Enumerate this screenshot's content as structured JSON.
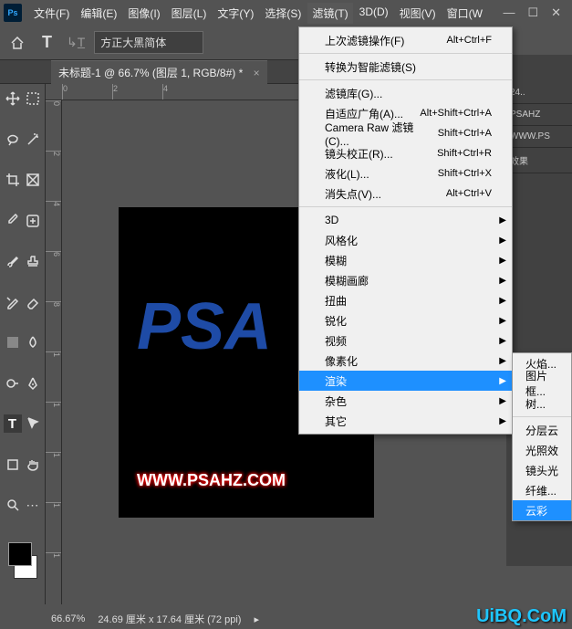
{
  "app": {
    "logo": "Ps"
  },
  "menubar": [
    "文件(F)",
    "编辑(E)",
    "图像(I)",
    "图层(L)",
    "文字(Y)",
    "选择(S)",
    "滤镜(T)",
    "3D(D)",
    "视图(V)",
    "窗口(W"
  ],
  "toolbar": {
    "font": "方正大黑简体"
  },
  "doc_tab": "未标题-1 @ 66.7% (图层 1, RGB/8#) *",
  "ruler_h": [
    "0",
    "2",
    "4"
  ],
  "ruler_v": [
    "0",
    "2",
    "4",
    "6",
    "8",
    "1",
    "1",
    "1",
    "1",
    "1"
  ],
  "canvas": {
    "big_text": "PSA",
    "url": "WWW.PSAHZ.COM"
  },
  "right_panel": {
    "row1": "24..",
    "row2": "PSAHZ",
    "row3": "WWW.PS",
    "row4": "效果"
  },
  "filter_menu": {
    "last": {
      "label": "上次滤镜操作(F)",
      "shortcut": "Alt+Ctrl+F"
    },
    "smart": {
      "label": "转换为智能滤镜(S)"
    },
    "items1": [
      {
        "label": "滤镜库(G)...",
        "shortcut": ""
      },
      {
        "label": "自适应广角(A)...",
        "shortcut": "Alt+Shift+Ctrl+A"
      },
      {
        "label": "Camera Raw 滤镜(C)...",
        "shortcut": "Shift+Ctrl+A"
      },
      {
        "label": "镜头校正(R)...",
        "shortcut": "Shift+Ctrl+R"
      },
      {
        "label": "液化(L)...",
        "shortcut": "Shift+Ctrl+X"
      },
      {
        "label": "消失点(V)...",
        "shortcut": "Alt+Ctrl+V"
      }
    ],
    "items2": [
      "3D",
      "风格化",
      "模糊",
      "模糊画廊",
      "扭曲",
      "锐化",
      "视频",
      "像素化",
      "渲染",
      "杂色",
      "其它"
    ]
  },
  "render_submenu": {
    "top": [
      "火焰...",
      "图片框...",
      "树..."
    ],
    "bottom": [
      "分层云",
      "光照效",
      "镜头光",
      "纤维...",
      "云彩"
    ]
  },
  "status": {
    "zoom": "66.67%",
    "dims": "24.69 厘米 x 17.64 厘米 (72 ppi)"
  },
  "watermark": "UiBQ.CoM"
}
